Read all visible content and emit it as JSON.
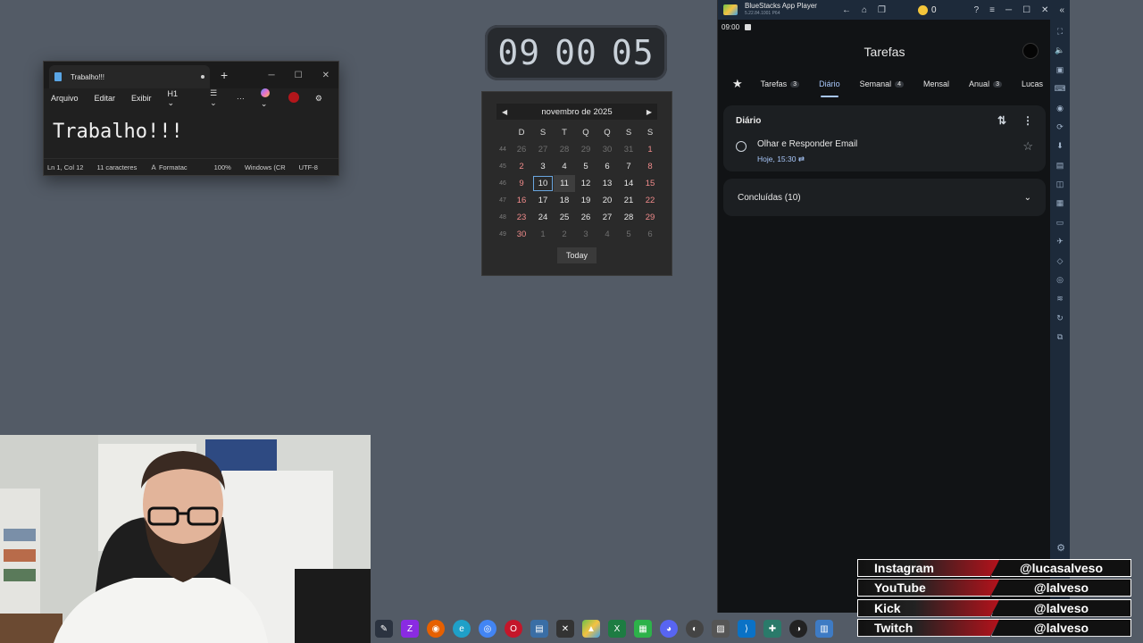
{
  "notepad": {
    "tab_title": "Trabalho!!!",
    "menu": [
      "Arquivo",
      "Editar",
      "Exibir"
    ],
    "heading_select": "H1",
    "more": "···",
    "content": "Trabalho!!!",
    "status": {
      "position": "Ln 1, Col 12",
      "chars": "11 caracteres",
      "format": "Formatac",
      "zoom": "100%",
      "line_ending": "Windows (CR",
      "encoding": "UTF-8"
    }
  },
  "clock": {
    "hours": "09",
    "minutes": "00",
    "seconds": "05"
  },
  "calendar": {
    "month_label": "novembro de 2025",
    "day_headers": [
      "D",
      "S",
      "T",
      "Q",
      "Q",
      "S",
      "S"
    ],
    "weeks": [
      {
        "wk": "44",
        "days": [
          "26",
          "27",
          "28",
          "29",
          "30",
          "31",
          "1"
        ]
      },
      {
        "wk": "45",
        "days": [
          "2",
          "3",
          "4",
          "5",
          "6",
          "7",
          "8"
        ]
      },
      {
        "wk": "46",
        "days": [
          "9",
          "10",
          "11",
          "12",
          "13",
          "14",
          "15"
        ]
      },
      {
        "wk": "47",
        "days": [
          "16",
          "17",
          "18",
          "19",
          "20",
          "21",
          "22"
        ]
      },
      {
        "wk": "48",
        "days": [
          "23",
          "24",
          "25",
          "26",
          "27",
          "28",
          "29"
        ]
      },
      {
        "wk": "49",
        "days": [
          "30",
          "1",
          "2",
          "3",
          "4",
          "5",
          "6"
        ]
      }
    ],
    "today_button": "Today"
  },
  "bluestacks": {
    "app_name": "BlueStacks App Player",
    "version": "5.22.84.1001 P64",
    "coins": "0",
    "status_time": "09:00",
    "screen_title": "Tarefas",
    "tabs": [
      {
        "label": "Tarefas",
        "count": "3"
      },
      {
        "label": "Diário",
        "count": ""
      },
      {
        "label": "Semanal",
        "count": "4"
      },
      {
        "label": "Mensal",
        "count": ""
      },
      {
        "label": "Anual",
        "count": "3"
      },
      {
        "label": "Lucas",
        "count": ""
      }
    ],
    "list_title": "Diário",
    "task": {
      "title": "Olhar e Responder Email",
      "due": "Hoje, 15:30"
    },
    "completed_label": "Concluídas (10)"
  },
  "socials": [
    {
      "platform": "Instagram",
      "handle": "@lucasalveso"
    },
    {
      "platform": "YouTube",
      "handle": "@lalveso"
    },
    {
      "platform": "Kick",
      "handle": "@lalveso"
    },
    {
      "platform": "Twitch",
      "handle": "@lalveso"
    }
  ],
  "colors": {
    "desktop": "#535b66",
    "accent_blue": "#a8c7fa",
    "social_red": "#b3121b"
  }
}
